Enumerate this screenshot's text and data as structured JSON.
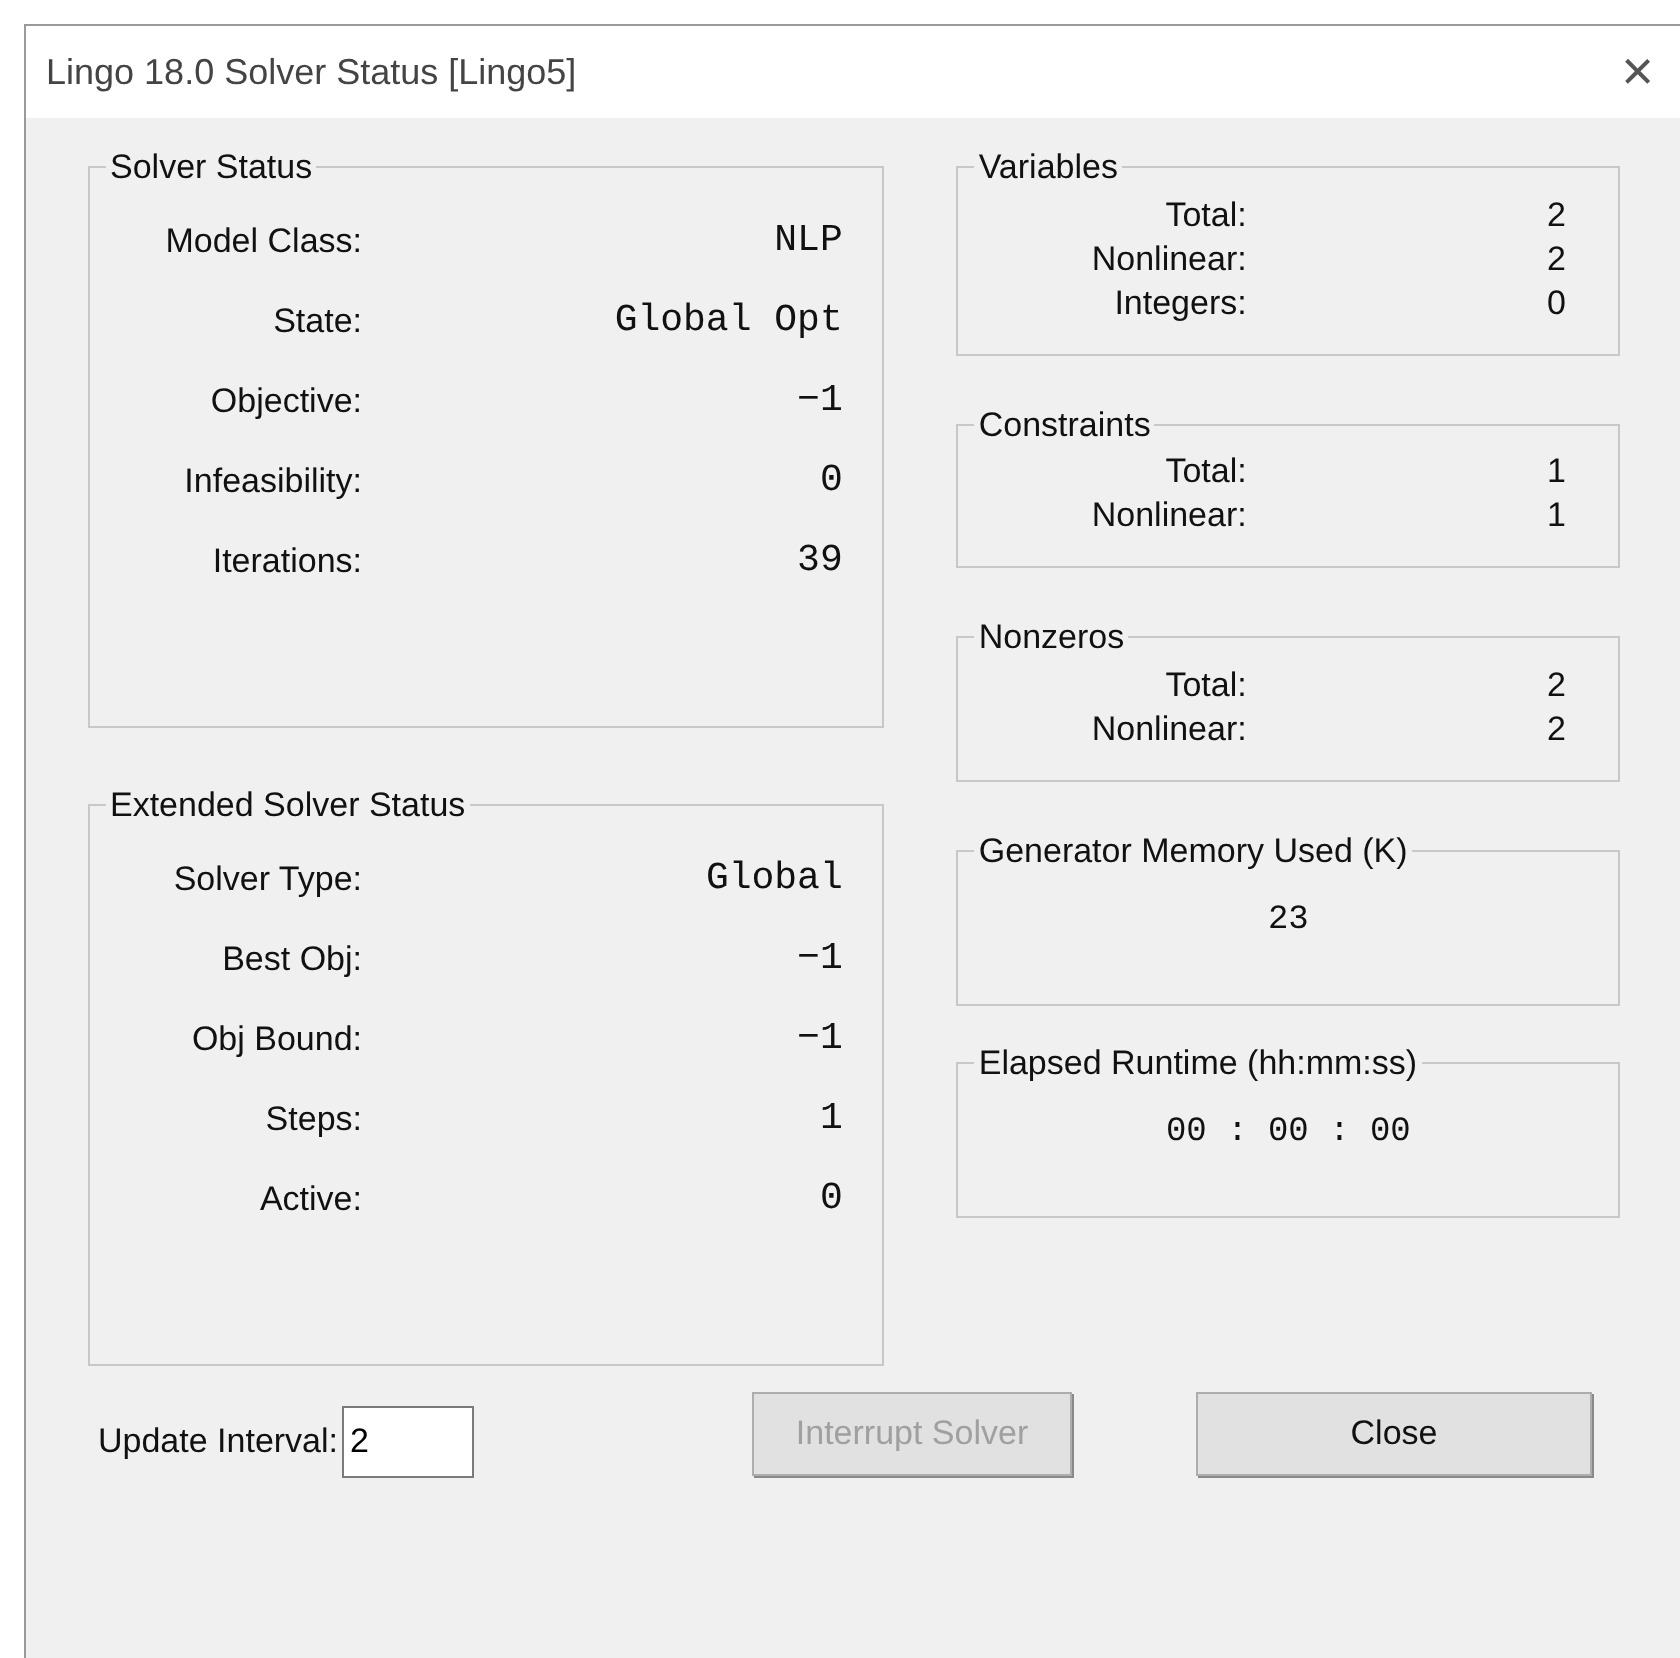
{
  "window": {
    "title": "Lingo 18.0 Solver Status [Lingo5]",
    "close": "×"
  },
  "left_groups": [
    {
      "title": "Solver Status",
      "rows": [
        {
          "label": "Model Class:",
          "value": "NLP"
        },
        {
          "label": "State:",
          "value": "Global Opt"
        },
        {
          "label": "Objective:",
          "value": "−1"
        },
        {
          "label": "Infeasibility:",
          "value": "0"
        },
        {
          "label": "Iterations:",
          "value": "39"
        }
      ]
    },
    {
      "title": "Extended Solver Status",
      "rows": [
        {
          "label": "Solver Type:",
          "value": "Global"
        },
        {
          "label": "Best Obj:",
          "value": "−1"
        },
        {
          "label": "Obj Bound:",
          "value": "−1"
        },
        {
          "label": "Steps:",
          "value": "1"
        },
        {
          "label": "Active:",
          "value": "0"
        }
      ]
    }
  ],
  "right_groups": [
    {
      "title": "Variables",
      "rows": [
        {
          "label": "Total:",
          "value": "2"
        },
        {
          "label": "Nonlinear:",
          "value": "2"
        },
        {
          "label": "Integers:",
          "value": "0"
        }
      ]
    },
    {
      "title": "Constraints",
      "rows": [
        {
          "label": "Total:",
          "value": "1"
        },
        {
          "label": "Nonlinear:",
          "value": "1"
        }
      ]
    },
    {
      "title": "Nonzeros",
      "rows": [
        {
          "label": "Total:",
          "value": "2"
        },
        {
          "label": "Nonlinear:",
          "value": "2"
        }
      ]
    }
  ],
  "readouts": [
    {
      "title": "Generator Memory Used (K)",
      "value": "23"
    },
    {
      "title": "Elapsed Runtime (hh:mm:ss)",
      "value": "00 : 00 : 00"
    }
  ],
  "update_interval": {
    "label": "Update Interval:",
    "value": "2"
  },
  "buttons": [
    {
      "label": "Interrupt Solver",
      "disabled": true
    },
    {
      "label": "Close",
      "disabled": false
    }
  ]
}
